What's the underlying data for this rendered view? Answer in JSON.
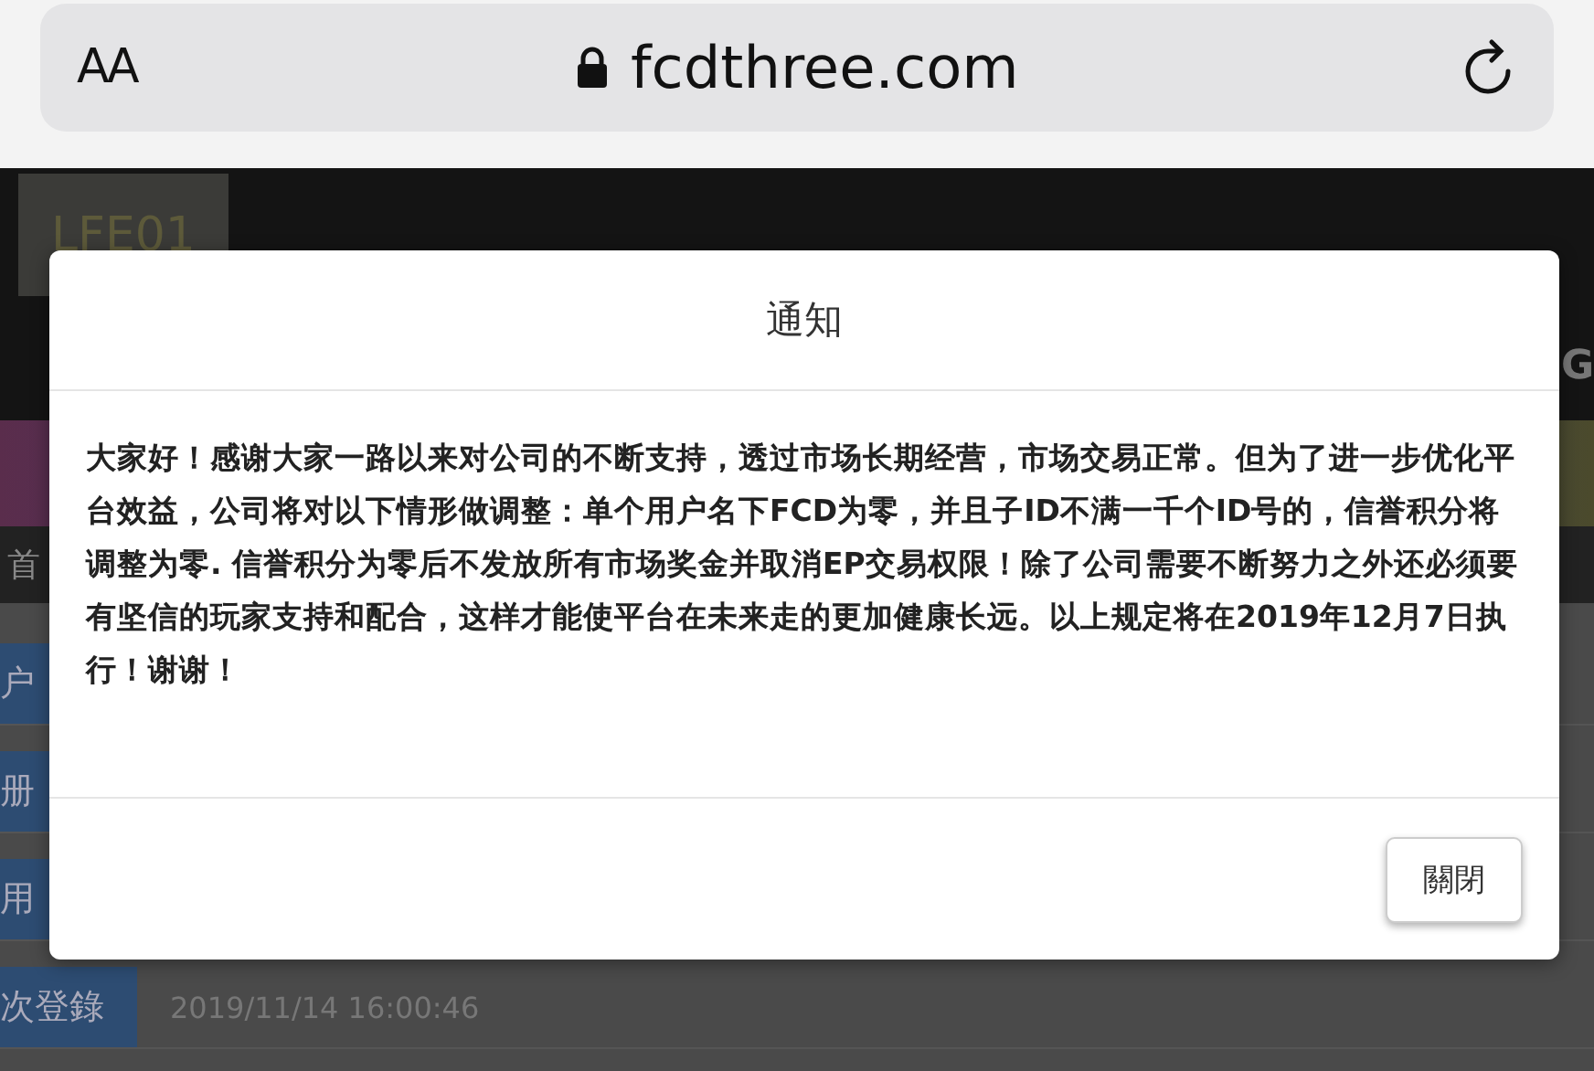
{
  "browser": {
    "text_size_button": "AA",
    "url": "fcdthree.com"
  },
  "page": {
    "brand": "LFE01",
    "edge_letter": "G",
    "nav_label": "首",
    "rows": [
      {
        "label": "户"
      },
      {
        "label": "册"
      },
      {
        "label": "用"
      },
      {
        "label": "次登錄",
        "value": "2019/11/14 16:00:46"
      }
    ]
  },
  "dialog": {
    "title": "通知",
    "message": "大家好！感谢大家一路以来对公司的不断支持，透过市场长期经营，市场交易正常。但为了进一步优化平台效益，公司将对以下情形做调整：单个用户名下FCD为零，并且子ID不满一千个ID号的，信誉积分将调整为零. 信誉积分为零后不发放所有市场奖金并取消EP交易权限！除了公司需要不断努力之外还必须要有坚信的玩家支持和配合，这样才能使平台在未来走的更加健康长远。以上规定将在2019年12月7日执行！谢谢！",
    "buttons": [
      "關閉"
    ]
  }
}
